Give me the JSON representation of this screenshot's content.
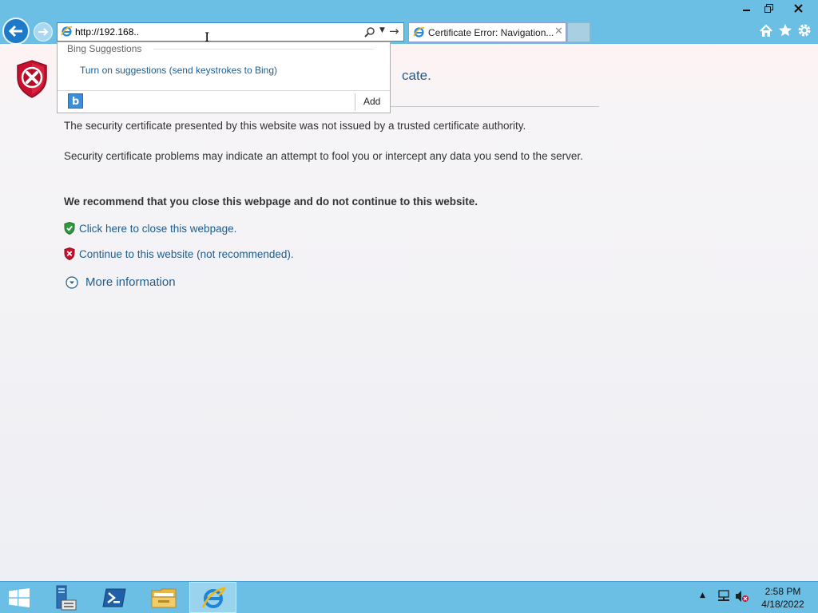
{
  "window": {
    "minimize_icon": "minimize-icon",
    "restore_icon": "restore-icon",
    "close_icon": "close-icon"
  },
  "address_bar": {
    "value": "http://192.168..",
    "icons": [
      "ie-page-icon",
      "search-icon",
      "dropdown-icon",
      "go-arrow-icon"
    ]
  },
  "tab": {
    "title": "Certificate Error: Navigation...",
    "close_glyph": "✕"
  },
  "toolbar_icons": [
    "home-icon",
    "favorites-star-icon",
    "gear-icon"
  ],
  "suggestions": {
    "heading": "Bing Suggestions",
    "link": "Turn on suggestions (send keystrokes to Bing)",
    "add_label": "Add",
    "bing_glyph": "b"
  },
  "page": {
    "title_fragment": "cate.",
    "para1": "The security certificate presented by this website was not issued by a trusted certificate authority.",
    "para2": "Security certificate problems may indicate an attempt to fool you or intercept any data you send to the server.",
    "recommend": "We recommend that you close this webpage and do not continue to this website.",
    "close_link": "Click here to close this webpage.",
    "continue_link": "Continue to this website (not recommended).",
    "more_info": "More information"
  },
  "taskbar": {
    "items": [
      "start-button",
      "server-manager",
      "powershell",
      "file-explorer",
      "internet-explorer"
    ],
    "active_item": "internet-explorer",
    "tray_icons": [
      "show-hidden-icons",
      "network-icon",
      "volume-muted-icon"
    ],
    "time": "2:58 PM",
    "date": "4/18/2022"
  },
  "colors": {
    "chrome_blue": "#6bbfe5",
    "link_blue": "#1f5d8d",
    "error_red": "#c8102e",
    "safe_green": "#2e9a3e"
  }
}
